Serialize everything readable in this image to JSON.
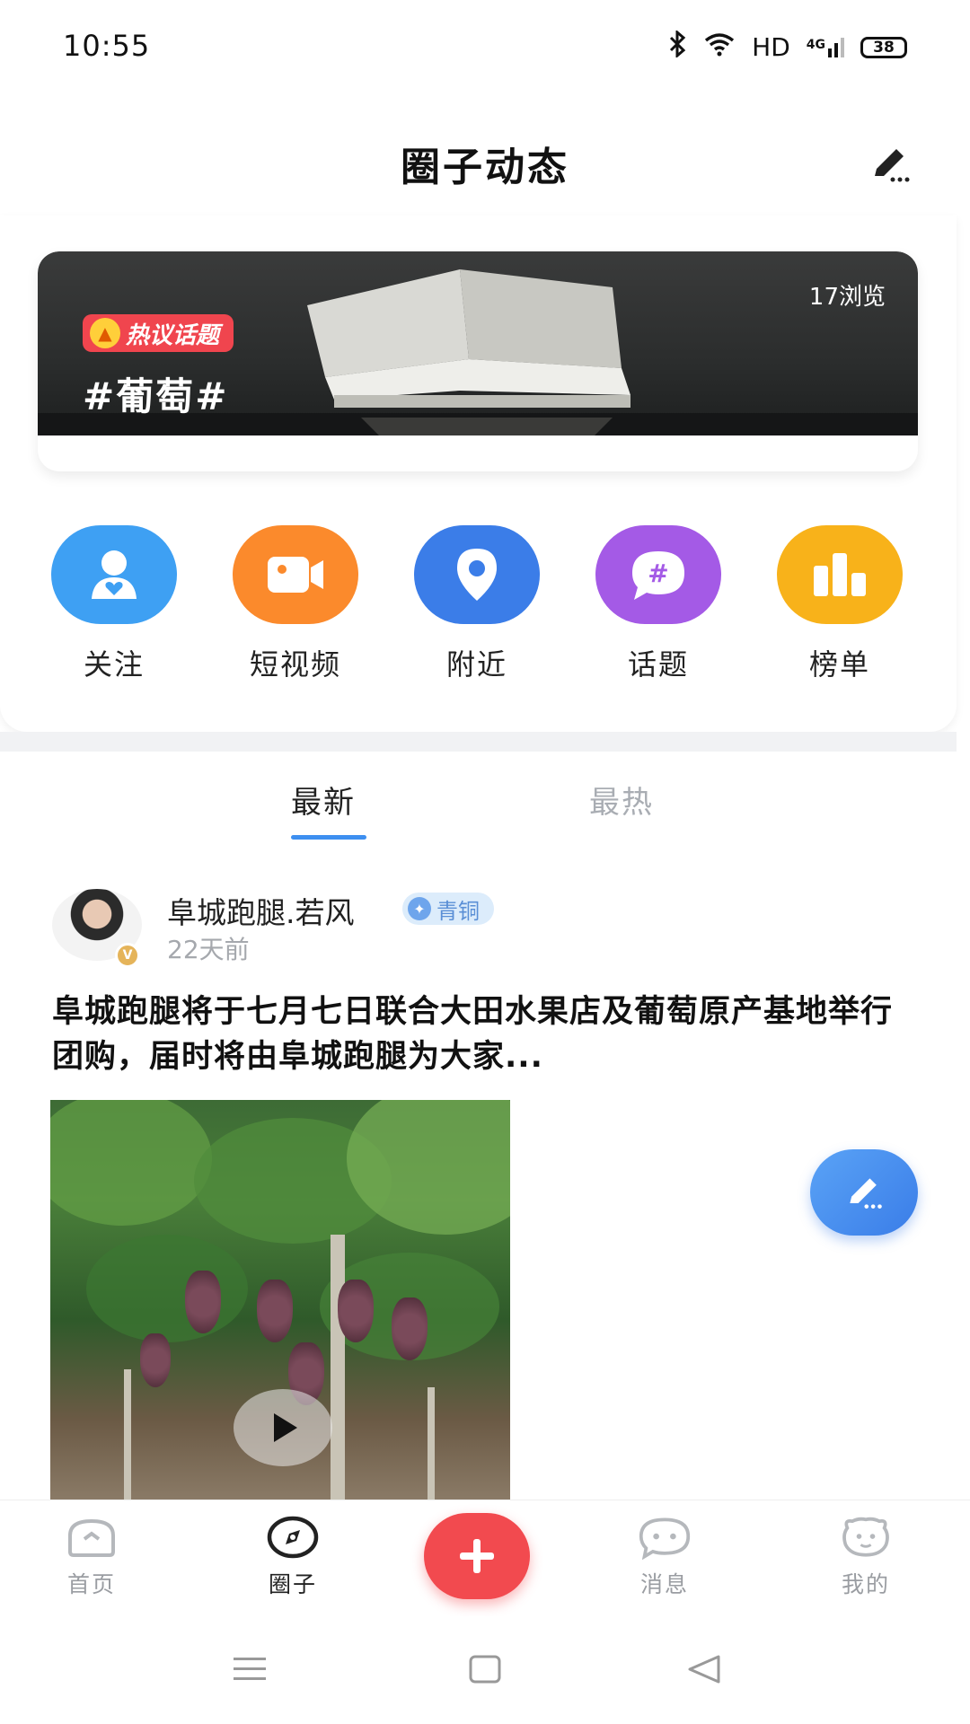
{
  "status_bar": {
    "time": "10:55",
    "network_label": "HD",
    "signal_label": "4G",
    "battery": "38"
  },
  "header": {
    "title": "圈子动态",
    "edit_icon": "edit-icon"
  },
  "banner": {
    "views": "17浏览",
    "badge": "热议话题",
    "topic": "#葡萄#"
  },
  "quick_links": [
    {
      "label": "关注",
      "icon": "user-heart-icon",
      "color": "#3ea0f3"
    },
    {
      "label": "短视频",
      "icon": "video-icon",
      "color": "#fb8a2c"
    },
    {
      "label": "附近",
      "icon": "location-icon",
      "color": "#3b7de8"
    },
    {
      "label": "话题",
      "icon": "topic-hash-icon",
      "color": "#a45ae6"
    },
    {
      "label": "榜单",
      "icon": "ranking-icon",
      "color": "#f8b21a"
    }
  ],
  "tabs": {
    "latest": "最新",
    "hot": "最热"
  },
  "post": {
    "author": "阜城跑腿.若风",
    "level": "青铜",
    "time": "22天前",
    "text": "阜城跑腿将于七月七日联合大田水果店及葡萄原产基地举行团购，届时将由阜城跑腿为大家..."
  },
  "bottom_nav": {
    "home": "首页",
    "circle": "圈子",
    "messages": "消息",
    "mine": "我的"
  },
  "colors": {
    "accent_blue": "#3d8ff0",
    "accent_red": "#f24a4f"
  }
}
